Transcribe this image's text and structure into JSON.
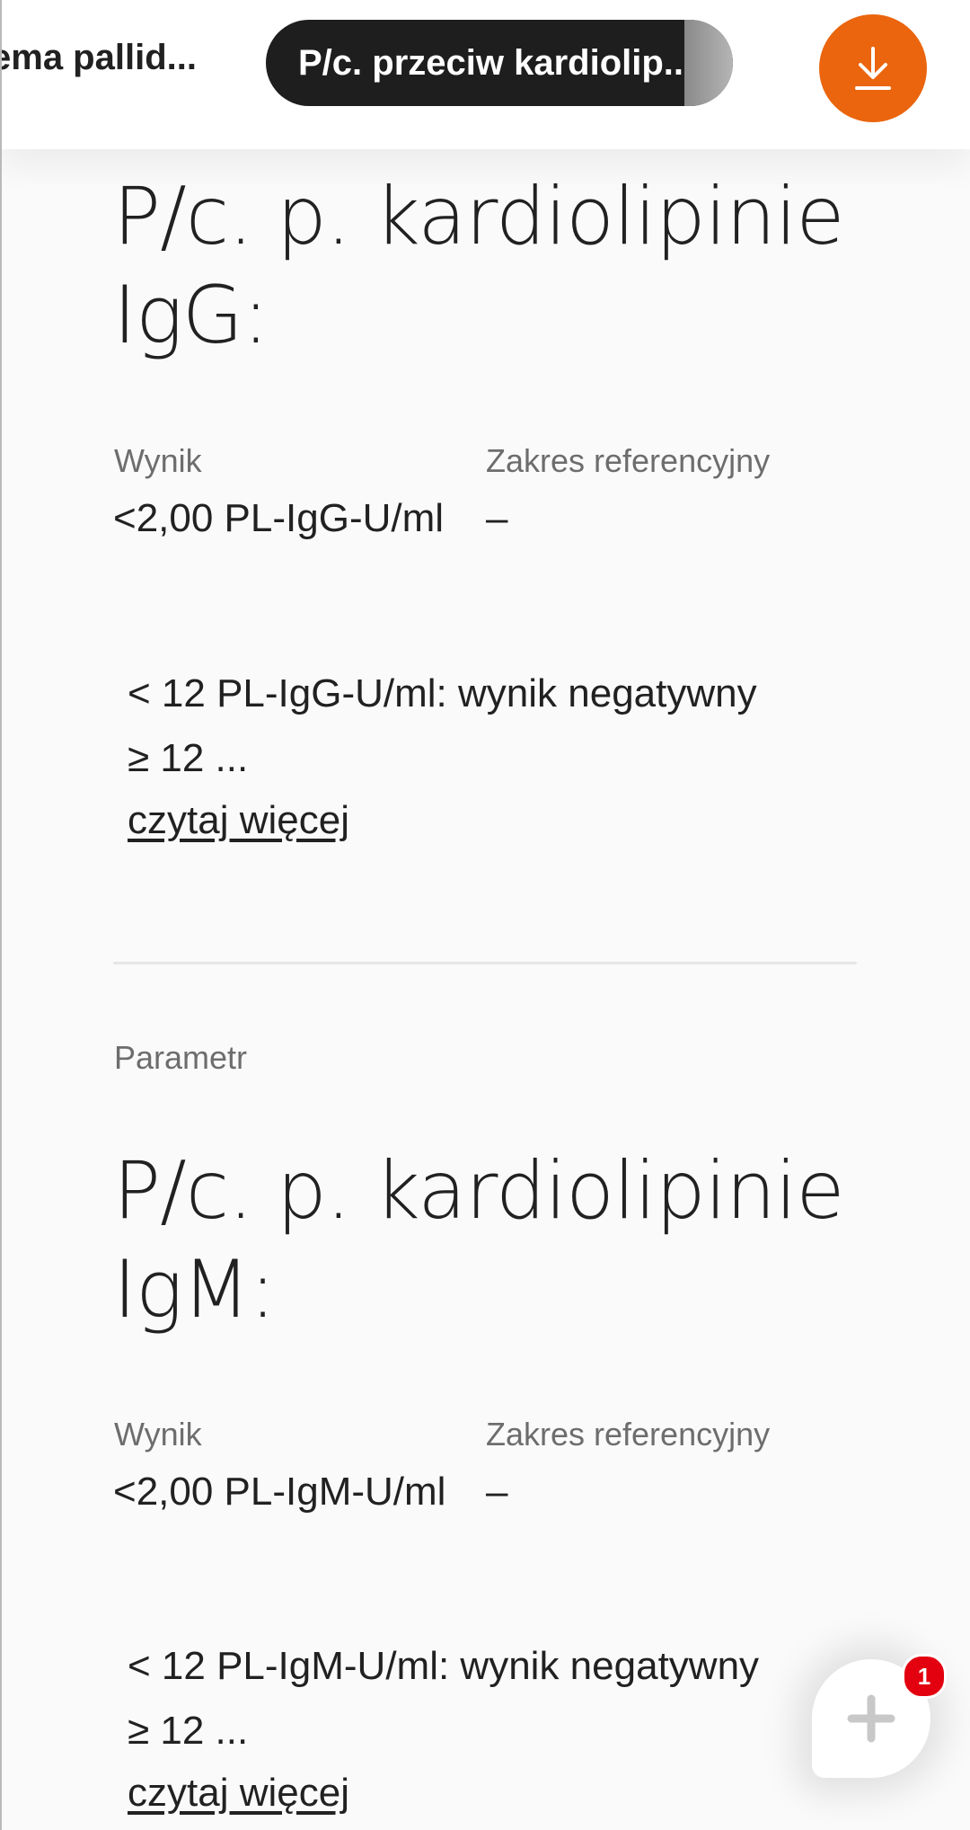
{
  "tabs": {
    "previous_label": "ema pallid...",
    "active_label": "P/c. przeciw kardiolip...",
    "download_icon": "download-icon",
    "accent_color": "#ea650d"
  },
  "parameters": [
    {
      "title": "P/c. p. kardiolipinie IgG:",
      "result_label": "Wynik",
      "result_value": "<2,00 PL-IgG-U/ml",
      "reference_label": "Zakres referencyjny",
      "reference_value": "–",
      "note_line1": "< 12 PL-IgG-U/ml: wynik negatywny",
      "note_line2": "≥ 12 ...",
      "read_more": "czytaj więcej"
    },
    {
      "section_label": "Parametr",
      "title": "P/c. p. kardiolipinie IgM:",
      "result_label": "Wynik",
      "result_value": "<2,00 PL-IgM-U/ml",
      "reference_label": "Zakres referencyjny",
      "reference_value": "–",
      "note_line1": "< 12 PL-IgM-U/ml: wynik negatywny",
      "note_line2": "≥ 12 ...",
      "read_more": "czytaj więcej"
    }
  ],
  "fab": {
    "icon": "plus-icon",
    "badge_count": "1",
    "badge_color": "#e3000f"
  }
}
